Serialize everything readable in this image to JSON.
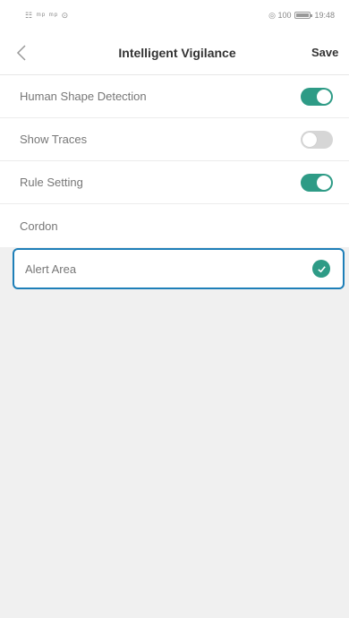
{
  "status_bar": {
    "left_glyphs": "☷ ᵐᵖ ᵐᵖ ⊙",
    "right_glyphs": "◎ 100",
    "time": "19:48"
  },
  "nav": {
    "title": "Intelligent Vigilance",
    "save_label": "Save"
  },
  "settings": [
    {
      "label": "Human Shape Detection",
      "toggle": "on"
    },
    {
      "label": "Show Traces",
      "toggle": "off"
    },
    {
      "label": "Rule Setting",
      "toggle": "on"
    },
    {
      "label": "Cordon"
    }
  ],
  "alert_area": {
    "label": "Alert Area",
    "selected": true
  },
  "colors": {
    "accent": "#2e9b86",
    "highlight_border": "#1e7fb8",
    "background": "#f0f0f0"
  }
}
